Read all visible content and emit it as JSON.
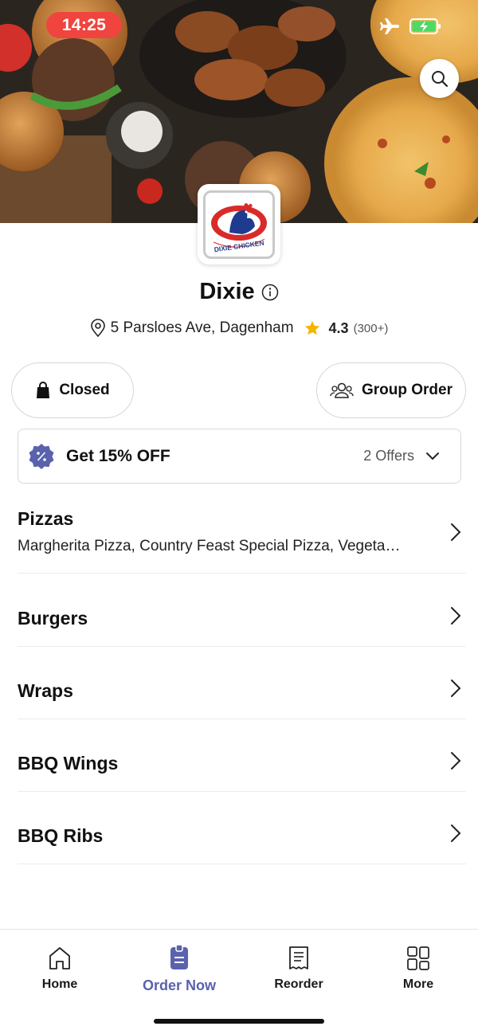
{
  "status_bar": {
    "time": "14:25"
  },
  "store": {
    "name": "Dixie",
    "logo_text": "DIXIE CHICKEN",
    "address": "5 Parsloes Ave, Dagenham",
    "rating": "4.3",
    "rating_count": "(300+)"
  },
  "actions": {
    "status_label": "Closed",
    "group_order_label": "Group Order"
  },
  "offer": {
    "title": "Get 15% OFF",
    "count_label": "2 Offers"
  },
  "categories": [
    {
      "title": "Pizzas",
      "subtitle": "Margherita Pizza, Country Feast Special Pizza, Vegeta…"
    },
    {
      "title": "Burgers"
    },
    {
      "title": "Wraps"
    },
    {
      "title": "BBQ Wings"
    },
    {
      "title": "BBQ Ribs"
    }
  ],
  "bottom_nav": [
    {
      "label": "Home",
      "icon": "home-icon",
      "active": false
    },
    {
      "label": "Order Now",
      "icon": "order-icon",
      "active": true
    },
    {
      "label": "Reorder",
      "icon": "receipt-icon",
      "active": false
    },
    {
      "label": "More",
      "icon": "grid-icon",
      "active": false
    }
  ],
  "colors": {
    "accent": "#5a62ad",
    "time_pill": "#f0443e",
    "star": "#f5b400",
    "battery": "#4cd964"
  }
}
